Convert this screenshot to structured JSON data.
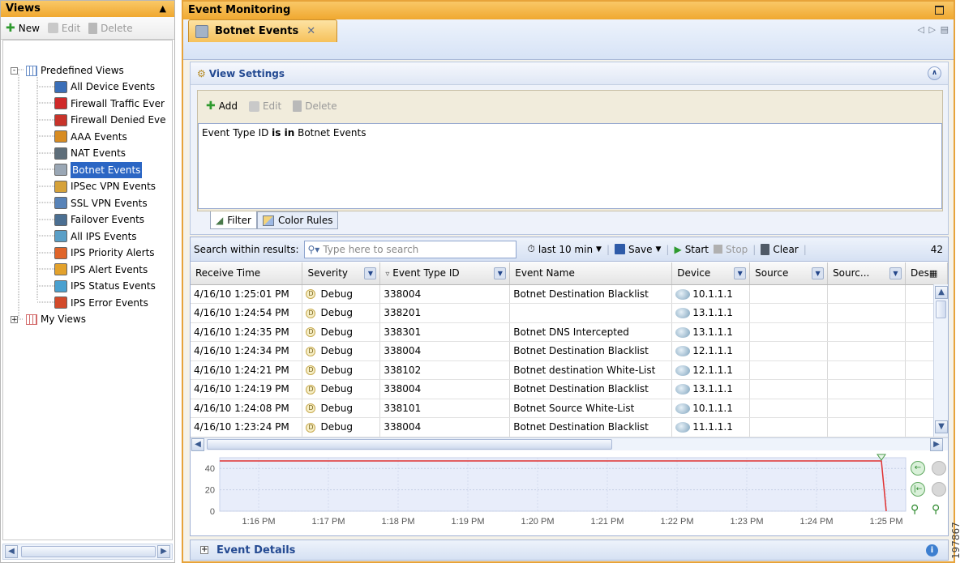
{
  "views_panel": {
    "title": "Views",
    "pin_glyph": "⮺",
    "toolbar": {
      "new": "New",
      "edit": "Edit",
      "delete": "Delete"
    },
    "tree": {
      "predefined": "Predefined Views",
      "items": [
        {
          "label": "All Device Events",
          "color": "#3b6fb8"
        },
        {
          "label": "Firewall Traffic Ever",
          "color": "#d02a2a"
        },
        {
          "label": "Firewall Denied Eve",
          "color": "#c8332a"
        },
        {
          "label": "AAA Events",
          "color": "#d88c22"
        },
        {
          "label": "NAT Events",
          "color": "#5e6e7a"
        },
        {
          "label": "Botnet Events",
          "color": "#9aa7b5"
        },
        {
          "label": "IPSec VPN Events",
          "color": "#d6a23a"
        },
        {
          "label": "SSL VPN Events",
          "color": "#5883b8"
        },
        {
          "label": "Failover Events",
          "color": "#4b6f92"
        },
        {
          "label": "All IPS Events",
          "color": "#5a9fc7"
        },
        {
          "label": "IPS Priority Alerts",
          "color": "#e0652a"
        },
        {
          "label": "IPS Alert Events",
          "color": "#e3a22c"
        },
        {
          "label": "IPS Status Events",
          "color": "#4aa1d0"
        },
        {
          "label": "IPS Error Events",
          "color": "#d34a2a"
        }
      ],
      "my_views": "My Views"
    }
  },
  "main": {
    "title": "Event Monitoring",
    "tab_label": "Botnet Events",
    "view_settings": {
      "title": "View Settings",
      "add": "Add",
      "edit": "Edit",
      "delete": "Delete",
      "filter_prefix": "Event Type ID ",
      "filter_op": "is in",
      "filter_value": " Botnet Events",
      "tab_filter": "Filter",
      "tab_color_rules": "Color Rules"
    },
    "results_toolbar": {
      "search_label": "Search within results:",
      "search_placeholder": "Type here to search",
      "time_range": "last 10 min",
      "save": "Save",
      "start": "Start",
      "stop": "Stop",
      "clear": "Clear",
      "count": "42"
    },
    "columns": [
      "Receive Time",
      "Severity",
      "Event Type ID",
      "Event Name",
      "Device",
      "Source",
      "Sourc...",
      "Des"
    ],
    "rows": [
      {
        "time": "4/16/10 1:25:01 PM",
        "severity": "Debug",
        "type_id": "338004",
        "name": "Botnet Destination Blacklist",
        "device": "10.1.1.1"
      },
      {
        "time": "4/16/10 1:24:54 PM",
        "severity": "Debug",
        "type_id": "338201",
        "name": "",
        "device": "13.1.1.1"
      },
      {
        "time": "4/16/10 1:24:35 PM",
        "severity": "Debug",
        "type_id": "338301",
        "name": "Botnet DNS Intercepted",
        "device": "13.1.1.1"
      },
      {
        "time": "4/16/10 1:24:34 PM",
        "severity": "Debug",
        "type_id": "338004",
        "name": "Botnet Destination Blacklist",
        "device": "12.1.1.1"
      },
      {
        "time": "4/16/10 1:24:21 PM",
        "severity": "Debug",
        "type_id": "338102",
        "name": "Botnet destination White-List",
        "device": "12.1.1.1"
      },
      {
        "time": "4/16/10 1:24:19 PM",
        "severity": "Debug",
        "type_id": "338004",
        "name": "Botnet Destination Blacklist",
        "device": "13.1.1.1"
      },
      {
        "time": "4/16/10 1:24:08 PM",
        "severity": "Debug",
        "type_id": "338101",
        "name": "Botnet Source White-List",
        "device": "10.1.1.1"
      },
      {
        "time": "4/16/10 1:23:24 PM",
        "severity": "Debug",
        "type_id": "338004",
        "name": "Botnet Destination Blacklist",
        "device": "11.1.1.1"
      }
    ],
    "event_details": "Event Details"
  },
  "chart_data": {
    "type": "line",
    "x": [
      "1:16 PM",
      "1:17 PM",
      "1:18 PM",
      "1:19 PM",
      "1:20 PM",
      "1:21 PM",
      "1:22 PM",
      "1:23 PM",
      "1:24 PM",
      "1:25 PM"
    ],
    "series": [
      {
        "values": [
          47,
          47,
          47,
          47,
          47,
          47,
          47,
          47,
          47,
          0
        ]
      }
    ],
    "y_ticks": [
      "40",
      "20",
      "0"
    ],
    "ylim": [
      0,
      50
    ],
    "line_color": "#e03030"
  },
  "side_label": "197867"
}
